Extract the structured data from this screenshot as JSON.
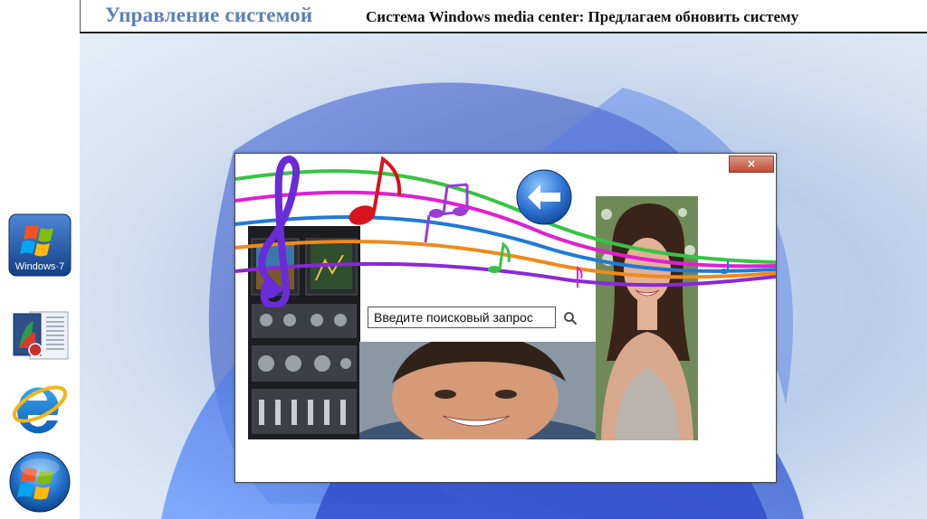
{
  "header": {
    "title": "Управление системой",
    "subtitle": "Система Windows media center: Предлагаем обновить систему"
  },
  "sidebar": {
    "icons": [
      {
        "name": "windows7-logo-icon",
        "label": "Windows·7"
      },
      {
        "name": "media-center-icon"
      },
      {
        "name": "internet-explorer-icon"
      },
      {
        "name": "windows-start-icon"
      }
    ]
  },
  "window": {
    "close_label": "×",
    "search": {
      "placeholder": "Введите поисковый запрос",
      "value": ""
    }
  },
  "colors": {
    "header_title": "#5b7fb8",
    "close_button": "#c44a36",
    "back_button": "#2a6fd0"
  }
}
